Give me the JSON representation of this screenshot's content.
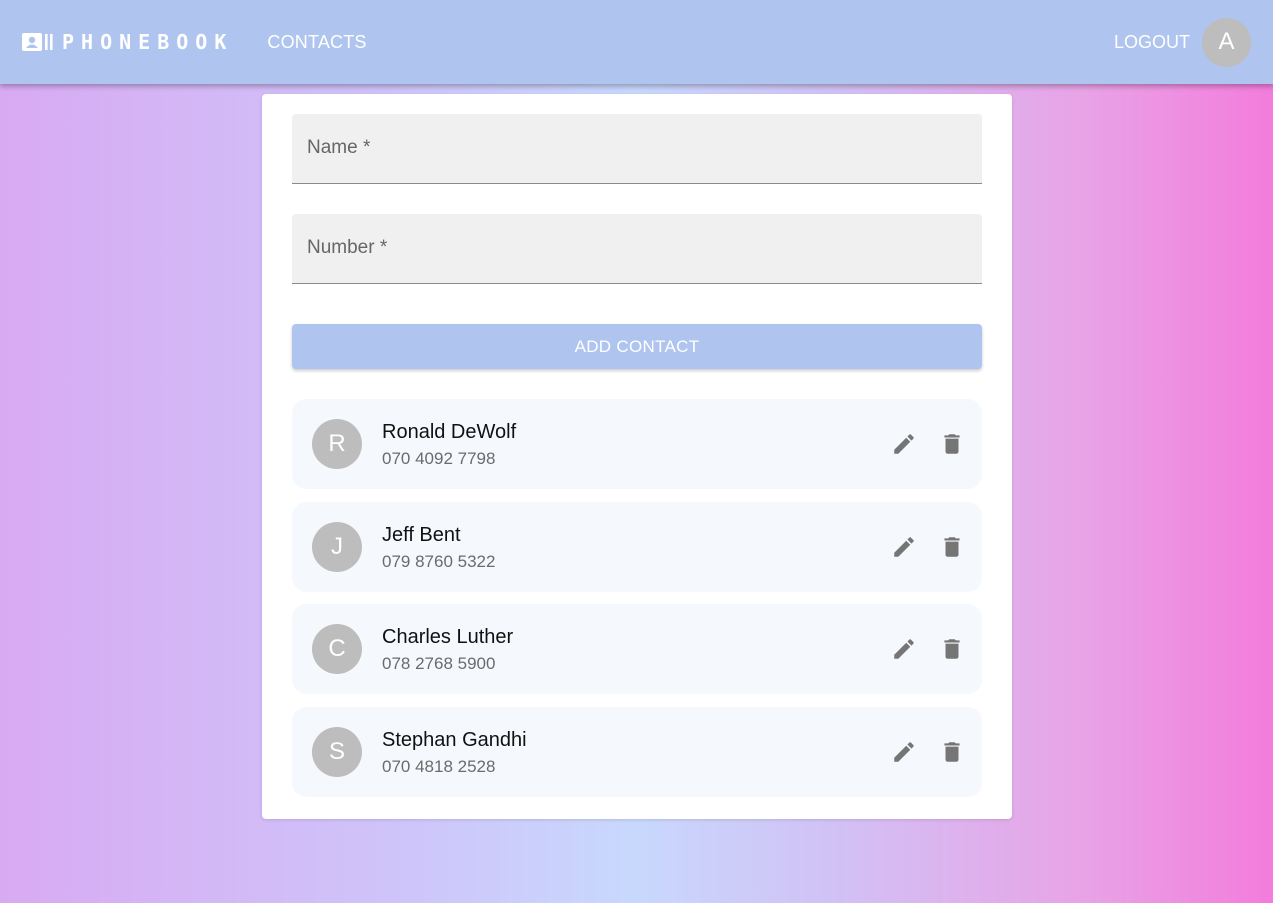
{
  "header": {
    "brand_title": "PHONEBOOK",
    "brand_icon": "contact-card-icon",
    "nav_contacts": "CONTACTS",
    "logout": "LOGOUT",
    "user_initial": "A",
    "bar_color": "#afc4ef"
  },
  "form": {
    "name_label": "Name *",
    "name_value": "",
    "number_label": "Number *",
    "number_value": "",
    "submit_label": "ADD CONTACT"
  },
  "contacts": [
    {
      "initial": "R",
      "name": "Ronald DeWolf",
      "number": "070 4092 7798"
    },
    {
      "initial": "J",
      "name": "Jeff Bent",
      "number": "079 8760 5322"
    },
    {
      "initial": "C",
      "name": "Charles Luther",
      "number": "078 2768 5900"
    },
    {
      "initial": "S",
      "name": "Stephan Gandhi",
      "number": "070 4818 2528"
    }
  ],
  "icons": {
    "edit": "pencil-icon",
    "delete": "trash-icon"
  }
}
